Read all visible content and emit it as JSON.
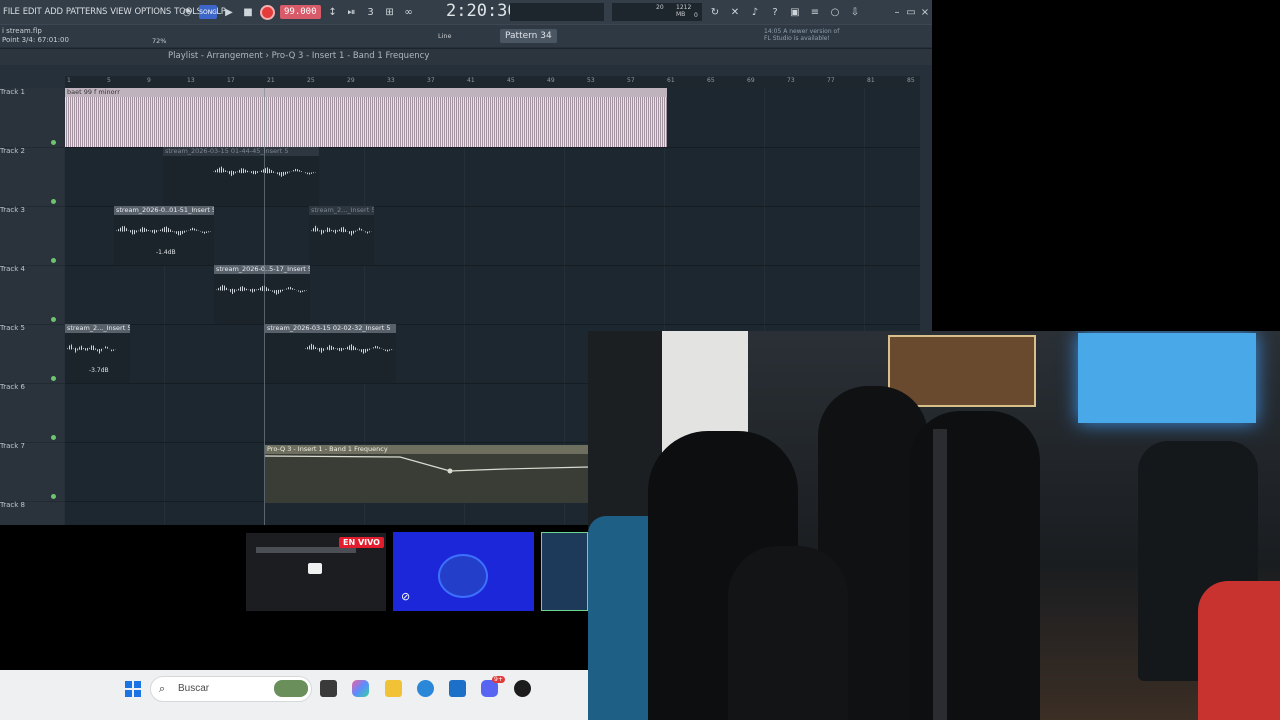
{
  "app": {
    "menu": [
      "FILE",
      "EDIT",
      "ADD",
      "PATTERNS",
      "VIEW",
      "OPTIONS",
      "TOOLS",
      "HELP"
    ],
    "tempo": "99.000",
    "time": "2:20:30",
    "project_file": "i stream.flp",
    "hint": "Point 3/4: 67:01:00",
    "zoom": "72%",
    "snap": "Line",
    "pattern": "Pattern 34",
    "notice": "14:05  A newer version of FL Studio is available!",
    "cpu_top": "20",
    "mem": "1212 MB",
    "voices": "0"
  },
  "playlist": {
    "breadcrumb": "Playlist - Arrangement › Pro-Q 3 - Insert 1 - Band 1 Frequency",
    "ruler_marks": [
      "1",
      "5",
      "9",
      "13",
      "17",
      "21",
      "25",
      "29",
      "33",
      "37",
      "41",
      "45",
      "49",
      "53",
      "57",
      "61",
      "65",
      "69",
      "73",
      "77",
      "81",
      "85"
    ],
    "tracks": [
      "Track 1",
      "Track 2",
      "Track 3",
      "Track 4",
      "Track 5",
      "Track 6",
      "Track 7",
      "Track 8"
    ],
    "clips": {
      "c1": "baet 99 f minorr",
      "c2": "stream_2026-03-15 01-44-45_Insert 5",
      "c3": "stream_2026-0..01-51_Insert 5",
      "c3db": "-1.4dB",
      "c3b": "stream_2..._Insert 5",
      "c4": "stream_2026-0..5-17_Insert 5",
      "c5": "stream_2..._Insert 5",
      "c5db": "-3.7dB",
      "c5b": "stream_2026-03-15 02-02-32_Insert 5",
      "c7": "Pro-Q 3 - Insert 1 - Band 1 Frequency"
    }
  },
  "overlay": {
    "live_badge": "EN VIVO"
  },
  "taskbar": {
    "search_placeholder": "Buscar",
    "discord_badge": "9+"
  }
}
